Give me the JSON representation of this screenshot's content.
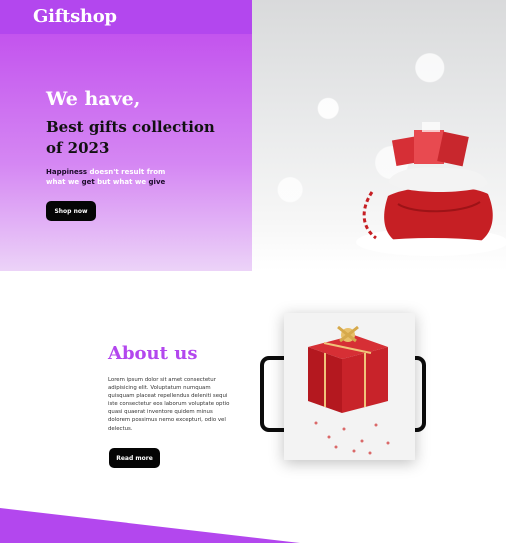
{
  "header": {
    "brand": "Giftshop",
    "icons": [
      "search-icon",
      "user-icon",
      "menu-icon"
    ]
  },
  "hero": {
    "title_line1": "We have,",
    "title_line2": "Best gifts collection of 2023",
    "subtitle_parts": [
      "Happiness",
      "doesn't result from",
      "what we",
      "get",
      "but what we",
      "give"
    ],
    "button_label": "Shop now"
  },
  "about": {
    "title": "About us",
    "text": "Lorem ipsum dolor sit amet consectetur adipisicing elit. Voluptatum numquam quisquam placeat repellendus deleniti sequi iste consectetur eos laborum voluptate optio quasi quaerat inventore quidem minus dolorem possimus nemo excepturi, odio vel delectus.",
    "button_label": "Read more"
  },
  "colors": {
    "brand_purple": "#b347ee",
    "button_black": "#050505"
  }
}
